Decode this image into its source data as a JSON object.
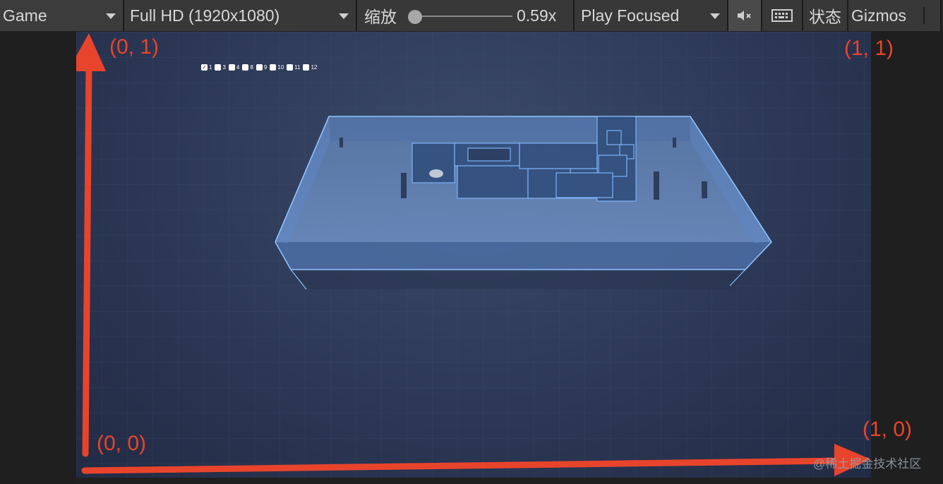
{
  "toolbar": {
    "view_label": "Game",
    "resolution_label": "Full HD (1920x1080)",
    "zoom_label": "缩放",
    "zoom_value": "0.59x",
    "zoom_level": 0.59,
    "play_mode_label": "Play Focused",
    "mute_icon": "mute-speaker-icon",
    "keyboard_icon": "keyboard-icon",
    "stats_label": "状态",
    "gizmos_label": "Gizmos"
  },
  "layer_toggles": [
    {
      "label": "1",
      "checked": true
    },
    {
      "label": "3",
      "checked": false
    },
    {
      "label": "4",
      "checked": false
    },
    {
      "label": "8",
      "checked": false
    },
    {
      "label": "9",
      "checked": false
    },
    {
      "label": "10",
      "checked": false
    },
    {
      "label": "11",
      "checked": false
    },
    {
      "label": "12",
      "checked": false
    }
  ],
  "annotations": {
    "top_left": "(0,  1)",
    "top_right": "(1,  1)",
    "bottom_left": "(0,  0)",
    "bottom_right": "(1,  0)"
  },
  "watermark": "@稀土掘金技术社区",
  "colors": {
    "annotation_red": "#e8442c",
    "scene_blue": "#5f86c6",
    "background": "#2c3856"
  }
}
